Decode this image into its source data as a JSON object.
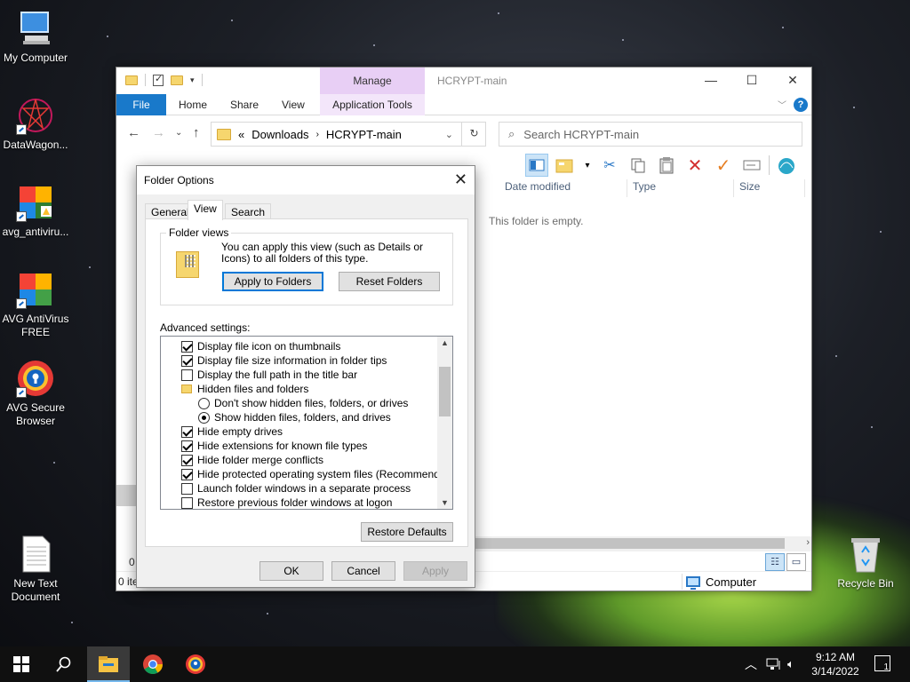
{
  "desktop": {
    "icons": [
      {
        "label": "My Computer"
      },
      {
        "label": "DataWagon..."
      },
      {
        "label": "avg_antiviru..."
      },
      {
        "label": "AVG AntiVirus FREE"
      },
      {
        "label": "AVG Secure Browser"
      },
      {
        "label": "New Text Document"
      },
      {
        "label": "Recycle Bin"
      }
    ]
  },
  "explorer": {
    "title": "HCRYPT-main",
    "context_tab": "Manage",
    "ribbon_tabs": [
      "File",
      "Home",
      "Share",
      "View",
      "Application Tools"
    ],
    "address": {
      "prefix": "«",
      "crumbs": [
        "Downloads",
        "HCRYPT-main"
      ]
    },
    "search_placeholder": "Search HCRYPT-main",
    "columns": [
      "Date modified",
      "Type",
      "Size"
    ],
    "empty_message": "This folder is empty.",
    "left_count": "0",
    "status_left": "0 ite",
    "status_location": "Computer"
  },
  "dialog": {
    "title": "Folder Options",
    "tabs": [
      "General",
      "View",
      "Search"
    ],
    "active_tab": "View",
    "folder_views": {
      "label": "Folder views",
      "description": "You can apply this view (such as Details or Icons) to all folders of this type.",
      "apply_button": "Apply to Folders",
      "reset_button": "Reset Folders"
    },
    "advanced_label": "Advanced settings:",
    "advanced_items": [
      {
        "type": "checkbox",
        "checked": true,
        "indent": 0,
        "label": "Display file icon on thumbnails"
      },
      {
        "type": "checkbox",
        "checked": true,
        "indent": 0,
        "label": "Display file size information in folder tips"
      },
      {
        "type": "checkbox",
        "checked": false,
        "indent": 0,
        "label": "Display the full path in the title bar"
      },
      {
        "type": "folder",
        "checked": false,
        "indent": 0,
        "label": "Hidden files and folders"
      },
      {
        "type": "radio",
        "checked": false,
        "indent": 1,
        "label": "Don't show hidden files, folders, or drives"
      },
      {
        "type": "radio",
        "checked": true,
        "indent": 1,
        "label": "Show hidden files, folders, and drives"
      },
      {
        "type": "checkbox",
        "checked": true,
        "indent": 0,
        "label": "Hide empty drives"
      },
      {
        "type": "checkbox",
        "checked": true,
        "indent": 0,
        "label": "Hide extensions for known file types"
      },
      {
        "type": "checkbox",
        "checked": true,
        "indent": 0,
        "label": "Hide folder merge conflicts"
      },
      {
        "type": "checkbox",
        "checked": true,
        "indent": 0,
        "label": "Hide protected operating system files (Recommended)"
      },
      {
        "type": "checkbox",
        "checked": false,
        "indent": 0,
        "label": "Launch folder windows in a separate process"
      },
      {
        "type": "checkbox",
        "checked": false,
        "indent": 0,
        "label": "Restore previous folder windows at logon"
      }
    ],
    "restore_button": "Restore Defaults",
    "ok_button": "OK",
    "cancel_button": "Cancel",
    "apply_button": "Apply"
  },
  "taskbar": {
    "time": "9:12 AM",
    "date": "3/14/2022",
    "notification_count": "1"
  },
  "colors": {
    "file_tab": "#1979ca",
    "manage_tab": "#e8cff5",
    "taskbar": "#101010",
    "accent": "#0078d7"
  }
}
